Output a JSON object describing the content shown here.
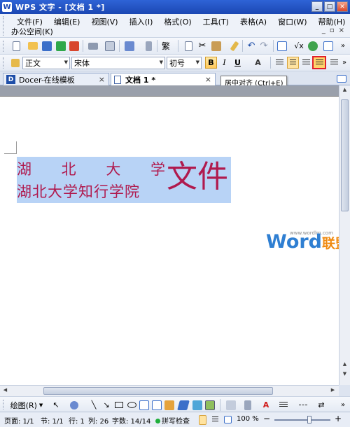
{
  "window": {
    "title": "WPS 文字 - [文档 1 *]",
    "logo": "W"
  },
  "window_controls": {
    "minimize": "_",
    "restore": "□",
    "close": "✕"
  },
  "menu": {
    "items": [
      "文件(F)",
      "编辑(E)",
      "视图(V)",
      "插入(I)",
      "格式(O)",
      "工具(T)",
      "表格(A)",
      "窗口(W)",
      "帮助(H)"
    ],
    "row2": "办公空间(K)",
    "doc_controls": [
      "_",
      "▫",
      "×"
    ]
  },
  "format_toolbar": {
    "style": "正文",
    "font": "宋体",
    "size": "初号",
    "bold": "B",
    "italic": "I",
    "underline": "U",
    "font_color": "A"
  },
  "tabs": [
    {
      "label": "Docer-在线模板",
      "close": "×",
      "logo": "D"
    },
    {
      "label": "文档 1 *",
      "close": "×"
    }
  ],
  "tooltip": "居中对齐 (Ctrl+E)",
  "document": {
    "line1_chars": [
      "湖",
      "北",
      "大",
      "学"
    ],
    "line2": "湖北大学知行学院",
    "big_text": "文件"
  },
  "watermark": {
    "url": "www.wordlm.com",
    "word": "Word",
    "cn": "联盟"
  },
  "drawbar": {
    "label": "绘图(R)"
  },
  "status": {
    "page": "页面: 1/1",
    "section": "节: 1/1",
    "line": "行: 1",
    "column": "列: 26",
    "chars": "字数: 14/14",
    "spell": "拼写检查",
    "zoom": "100 %",
    "zoom_minus": "−",
    "zoom_plus": "+",
    "zoom_level": 1.0
  },
  "colors": {
    "title_bar": "#1b47b3",
    "doc_text": "#b01a4e",
    "selection": "#b8d3f6",
    "highlight_border": "#e0202c",
    "watermark_blue": "#2f7fd2",
    "watermark_orange": "#f08a10"
  },
  "icons": [
    "new-doc-icon",
    "open-folder-icon",
    "save-icon",
    "print-icon",
    "cut-icon",
    "copy-icon",
    "paste-icon",
    "undo-icon",
    "redo-icon",
    "align-left-icon",
    "align-center-icon",
    "align-right-icon",
    "justify-icon",
    "line-tool-icon",
    "arrow-tool-icon",
    "rectangle-tool-icon",
    "ellipse-tool-icon"
  ]
}
